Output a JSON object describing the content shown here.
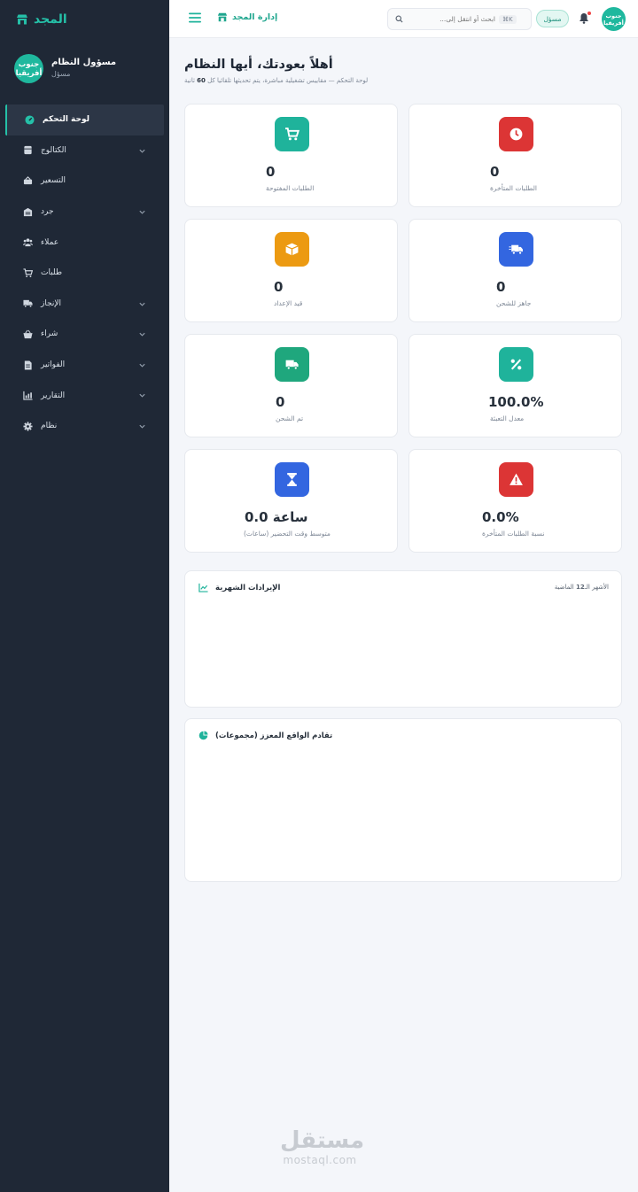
{
  "sidebar": {
    "brand": "المجد",
    "user": {
      "avatar": "جنوب أفريقيا",
      "name": "مسؤول النظام",
      "role": "مسؤل"
    },
    "items": [
      {
        "label": "لوحة التحكم",
        "icon": "dashboard-icon",
        "active": true,
        "has_children": false
      },
      {
        "label": "الكتالوج",
        "icon": "box-icon",
        "active": false,
        "has_children": true
      },
      {
        "label": "التسعير",
        "icon": "tag-icon",
        "active": false,
        "has_children": false
      },
      {
        "label": "جرد",
        "icon": "warehouse-icon",
        "active": false,
        "has_children": true
      },
      {
        "label": "عملاء",
        "icon": "users-icon",
        "active": false,
        "has_children": false
      },
      {
        "label": "طلبات",
        "icon": "cart-icon",
        "active": false,
        "has_children": false
      },
      {
        "label": "الإنجاز",
        "icon": "truck-icon",
        "active": false,
        "has_children": true
      },
      {
        "label": "شراء",
        "icon": "basket-icon",
        "active": false,
        "has_children": true
      },
      {
        "label": "الفواتير",
        "icon": "invoice-icon",
        "active": false,
        "has_children": true
      },
      {
        "label": "التقارير",
        "icon": "report-icon",
        "active": false,
        "has_children": true
      },
      {
        "label": "نظام",
        "icon": "gear-icon",
        "active": false,
        "has_children": true
      }
    ]
  },
  "topbar": {
    "brand": "إدارة المجد",
    "search_placeholder": "ابحث أو انتقل إلى...",
    "search_shortcut": "⌘K",
    "role_pill": "مسؤل",
    "avatar": "جنوب أفريقيا"
  },
  "header": {
    "title": "أهلاً بعودتك، أيها النظام",
    "subtitle_prefix": "لوحة التحكم — مقاييس تشغيلية مباشرة، يتم تحديثها تلقائيا كل",
    "subtitle_number": "60",
    "subtitle_suffix": "ثانية"
  },
  "cards": [
    {
      "value": "0",
      "label": "الطلبات المفتوحة",
      "icon": "cart-icon",
      "color": "#1fb39b"
    },
    {
      "value": "0",
      "label": "الطلبات المتأخرة",
      "icon": "clock-icon",
      "color": "#dc3535"
    },
    {
      "value": "0",
      "label": "قيد الإعداد",
      "icon": "box-open-icon",
      "color": "#ec9a12"
    },
    {
      "value": "0",
      "label": "جاهز للشحن",
      "icon": "truck-fast-icon",
      "color": "#3366e0"
    },
    {
      "value": "0",
      "label": "تم الشحن",
      "icon": "truck-icon",
      "color": "#1fa77d"
    },
    {
      "value": "100.0%",
      "label": "معدل التعبئة",
      "icon": "percent-icon",
      "color": "#1fb39b"
    },
    {
      "value": "0.0 ساعة",
      "label": "متوسط وقت التحضير (ساعات)",
      "icon": "hourglass-icon",
      "color": "#3366e0"
    },
    {
      "value": "0.0%",
      "label": "نسبة الطلبات المتأخرة",
      "icon": "warning-icon",
      "color": "#dc3535"
    }
  ],
  "panels": {
    "revenue": {
      "title": "الإيرادات الشهرية",
      "meta_prefix": "الأشهر الـ",
      "meta_number": "12",
      "meta_suffix": "الماضية"
    },
    "aging": {
      "title": "تقادم الواقع المعزز (مجموعات)"
    }
  },
  "watermark": {
    "ar": "مستقل",
    "en": "mostaql.com"
  },
  "colors": {
    "accent": "#1fb89e",
    "sidebar_bg": "#1f2836",
    "page_bg": "#f4f6fa"
  }
}
